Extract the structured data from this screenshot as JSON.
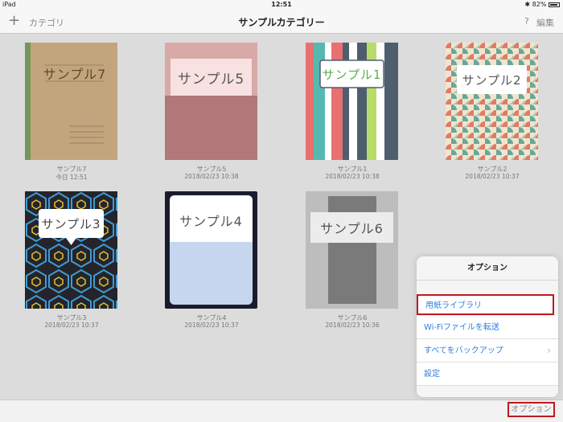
{
  "status_bar": {
    "device": "iPad",
    "time": "12:51",
    "battery": "82%"
  },
  "nav": {
    "add_label": "+",
    "category_label": "カテゴリ",
    "title": "サンプルカテゴリー",
    "help_label": "?",
    "edit_label": "編集"
  },
  "notebooks": [
    {
      "name": "サンプル7",
      "date": "今日 12:51",
      "cover_text": "サンプル7"
    },
    {
      "name": "サンプル5",
      "date": "2018/02/23 10:38",
      "cover_text": "サンプル5"
    },
    {
      "name": "サンプル1",
      "date": "2018/02/23 10:38",
      "cover_text": "サンプル1"
    },
    {
      "name": "サンプル2",
      "date": "2018/02/23 10:37",
      "cover_text": "サンプル2"
    },
    {
      "name": "サンプル3",
      "date": "2018/02/23 10:37",
      "cover_text": "サンプル3"
    },
    {
      "name": "サンプル4",
      "date": "2018/02/23 10:37",
      "cover_text": "サンプル4"
    },
    {
      "name": "サンプル6",
      "date": "2018/02/23 10:36",
      "cover_text": "サンプル6"
    }
  ],
  "popover": {
    "title": "オプション",
    "items": [
      {
        "label": "用紙ライブラリ"
      },
      {
        "label": "Wi-Fiファイルを転送"
      },
      {
        "label": "すべてをバックアップ",
        "chevron": "›"
      },
      {
        "label": "設定"
      }
    ]
  },
  "options_button_label": "オプション",
  "colors": {
    "highlight": "#c0191f",
    "link": "#2f7de1"
  }
}
